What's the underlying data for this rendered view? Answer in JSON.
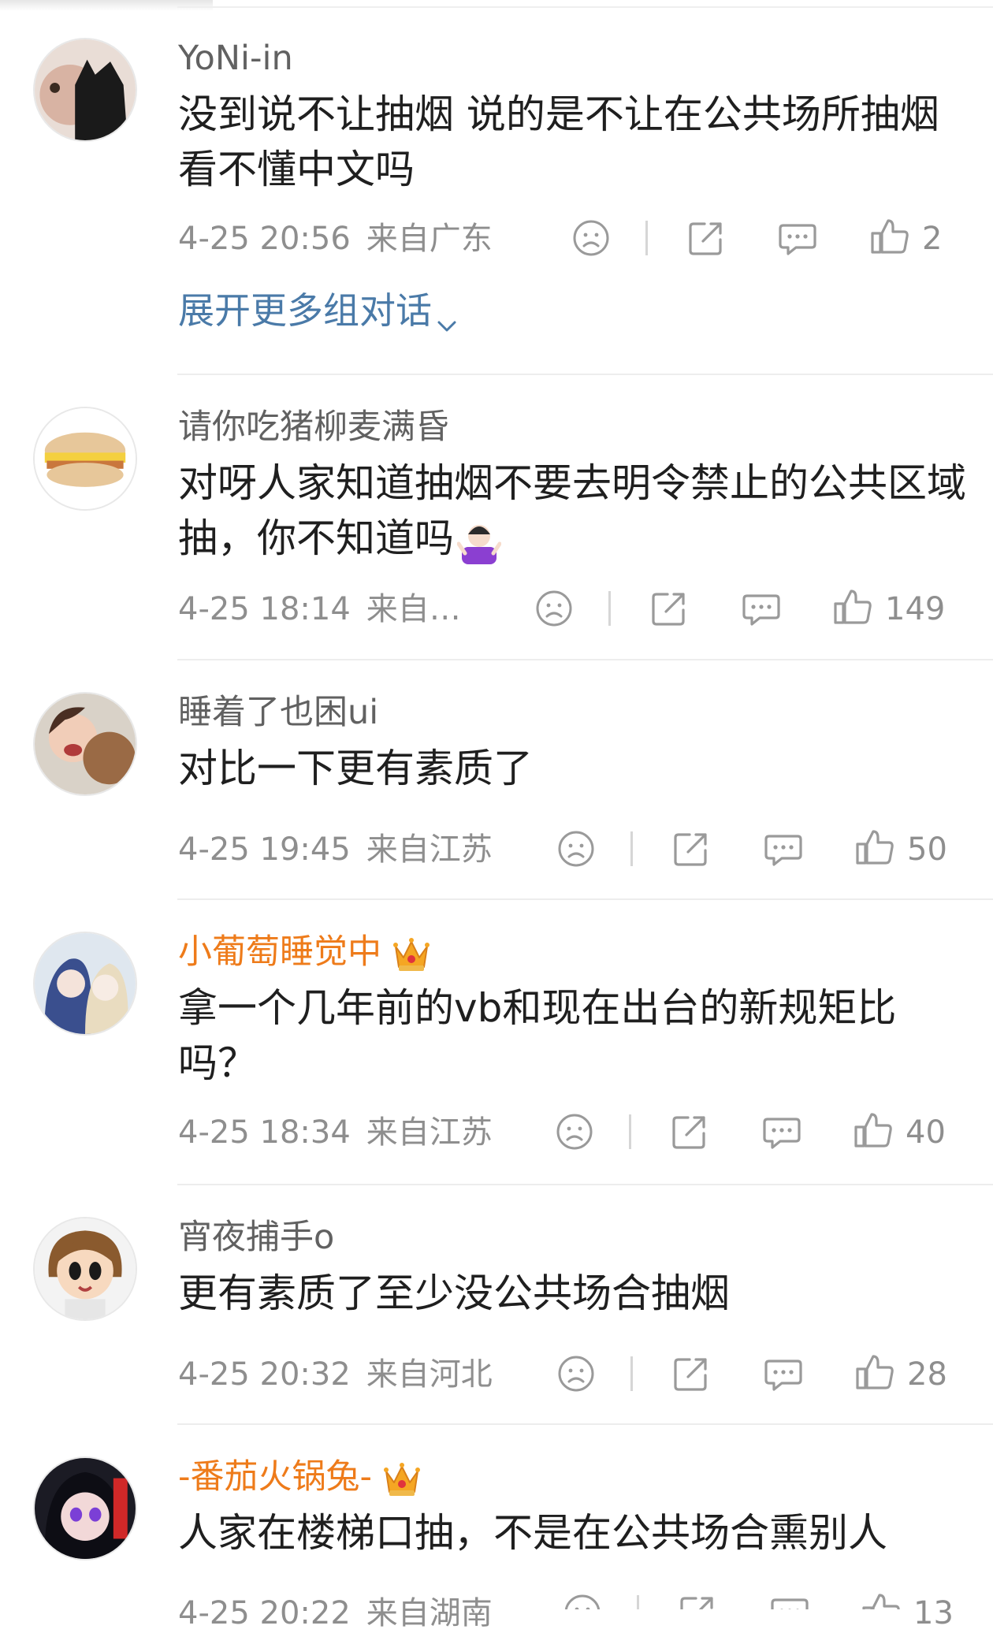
{
  "comments": [
    {
      "username": "YoNi-in",
      "text": "没到说不让抽烟 说的是不让在公共场所抽烟 看不懂中文吗",
      "time": "4-25 20:56",
      "location": "来自广东",
      "likes": "2",
      "expand": "展开更多组对话"
    },
    {
      "username": "请你吃猪柳麦满昏",
      "text": "对呀人家知道抽烟不要去明令禁止的公共区域抽，你不知道吗",
      "time": "4-25 18:14",
      "location": "来自…",
      "likes": "149"
    },
    {
      "username": "睡着了也困ui",
      "text": "对比一下更有素质了",
      "time": "4-25 19:45",
      "location": "来自江苏",
      "likes": "50"
    },
    {
      "username": "小葡萄睡觉中",
      "text": "拿一个几年前的vb和现在出台的新规矩比吗？",
      "time": "4-25 18:34",
      "location": "来自江苏",
      "likes": "40"
    },
    {
      "username": "宵夜捕手o",
      "text": "更有素质了至少没公共场合抽烟",
      "time": "4-25 20:32",
      "location": "来自河北",
      "likes": "28"
    },
    {
      "username": "-番茄火锅兔-",
      "text": "人家在楼梯口抽，不是在公共场合熏别人",
      "time": "4-25 20:22",
      "location": "来自湖南",
      "likes": "13"
    }
  ],
  "icons": {
    "dislike": "sad-face-icon",
    "share": "share-icon",
    "reply": "comment-bubble-icon",
    "like": "thumbs-up-icon",
    "expand": "chevron-down-icon",
    "vip": "crown-icon",
    "emoji": "shrug-emoji-icon"
  },
  "colors": {
    "vip_name": "#ee7b1a",
    "link": "#4a7aa8",
    "meta": "#8e8e8e",
    "text": "#1f1f1f"
  }
}
